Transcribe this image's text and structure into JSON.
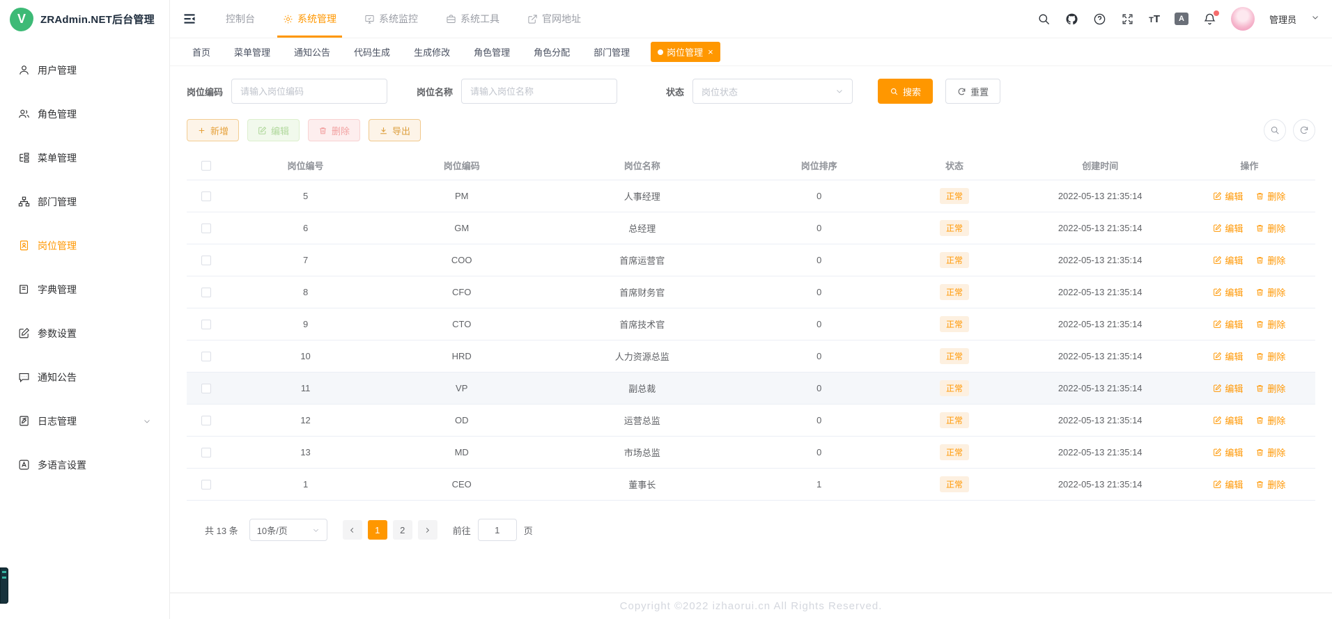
{
  "app": {
    "title": "ZRAdmin.NET后台管理",
    "logo_letter": "V"
  },
  "topnav": {
    "items": [
      {
        "label": "控制台"
      },
      {
        "label": "系统管理",
        "active": true
      },
      {
        "label": "系统监控"
      },
      {
        "label": "系统工具"
      },
      {
        "label": "官网地址"
      }
    ],
    "user_name": "管理员",
    "lang_glyph": "A",
    "fontsize_glyph": "T"
  },
  "sidebar": {
    "items": [
      {
        "label": "用户管理"
      },
      {
        "label": "角色管理"
      },
      {
        "label": "菜单管理"
      },
      {
        "label": "部门管理"
      },
      {
        "label": "岗位管理",
        "active": true
      },
      {
        "label": "字典管理"
      },
      {
        "label": "参数设置"
      },
      {
        "label": "通知公告"
      },
      {
        "label": "日志管理",
        "expandable": true
      },
      {
        "label": "多语言设置"
      }
    ]
  },
  "tabs": [
    {
      "label": "首页"
    },
    {
      "label": "菜单管理"
    },
    {
      "label": "通知公告"
    },
    {
      "label": "代码生成"
    },
    {
      "label": "生成修改"
    },
    {
      "label": "角色管理"
    },
    {
      "label": "角色分配"
    },
    {
      "label": "部门管理"
    },
    {
      "label": "岗位管理",
      "active": true,
      "close_glyph": "×"
    }
  ],
  "filters": {
    "code_label": "岗位编码",
    "code_placeholder": "请输入岗位编码",
    "name_label": "岗位名称",
    "name_placeholder": "请输入岗位名称",
    "status_label": "状态",
    "status_placeholder": "岗位状态",
    "search_label": "搜索",
    "reset_label": "重置"
  },
  "toolbar": {
    "add_label": "新增",
    "edit_label": "编辑",
    "delete_label": "删除",
    "export_label": "导出"
  },
  "table": {
    "headers": [
      "岗位编号",
      "岗位编码",
      "岗位名称",
      "岗位排序",
      "状态",
      "创建时间",
      "操作"
    ],
    "edit_label": "编辑",
    "delete_label": "删除",
    "rows": [
      {
        "id": "5",
        "code": "PM",
        "name": "人事经理",
        "sort": "0",
        "status": "正常",
        "time": "2022-05-13 21:35:14"
      },
      {
        "id": "6",
        "code": "GM",
        "name": "总经理",
        "sort": "0",
        "status": "正常",
        "time": "2022-05-13 21:35:14"
      },
      {
        "id": "7",
        "code": "COO",
        "name": "首席运营官",
        "sort": "0",
        "status": "正常",
        "time": "2022-05-13 21:35:14"
      },
      {
        "id": "8",
        "code": "CFO",
        "name": "首席财务官",
        "sort": "0",
        "status": "正常",
        "time": "2022-05-13 21:35:14"
      },
      {
        "id": "9",
        "code": "CTO",
        "name": "首席技术官",
        "sort": "0",
        "status": "正常",
        "time": "2022-05-13 21:35:14"
      },
      {
        "id": "10",
        "code": "HRD",
        "name": "人力资源总监",
        "sort": "0",
        "status": "正常",
        "time": "2022-05-13 21:35:14"
      },
      {
        "id": "11",
        "code": "VP",
        "name": "副总裁",
        "sort": "0",
        "status": "正常",
        "time": "2022-05-13 21:35:14",
        "highlight": true
      },
      {
        "id": "12",
        "code": "OD",
        "name": "运营总监",
        "sort": "0",
        "status": "正常",
        "time": "2022-05-13 21:35:14"
      },
      {
        "id": "13",
        "code": "MD",
        "name": "市场总监",
        "sort": "0",
        "status": "正常",
        "time": "2022-05-13 21:35:14"
      },
      {
        "id": "1",
        "code": "CEO",
        "name": "董事长",
        "sort": "1",
        "status": "正常",
        "time": "2022-05-13 21:35:14"
      }
    ]
  },
  "pagination": {
    "total_label": "共 13 条",
    "page_size_label": "10条/页",
    "pages": [
      {
        "label": "1",
        "active": true
      },
      {
        "label": "2"
      }
    ],
    "goto_label": "前往",
    "goto_value": "1",
    "unit_label": "页"
  },
  "footer": {
    "copyright": "Copyright ©2022 izhaorui.cn All Rights Reserved."
  },
  "colors": {
    "accent": "#ff9700",
    "success_tag_bg": "#fdf0e0",
    "logo_green": "#3dba76",
    "danger": "#f56c6c"
  }
}
